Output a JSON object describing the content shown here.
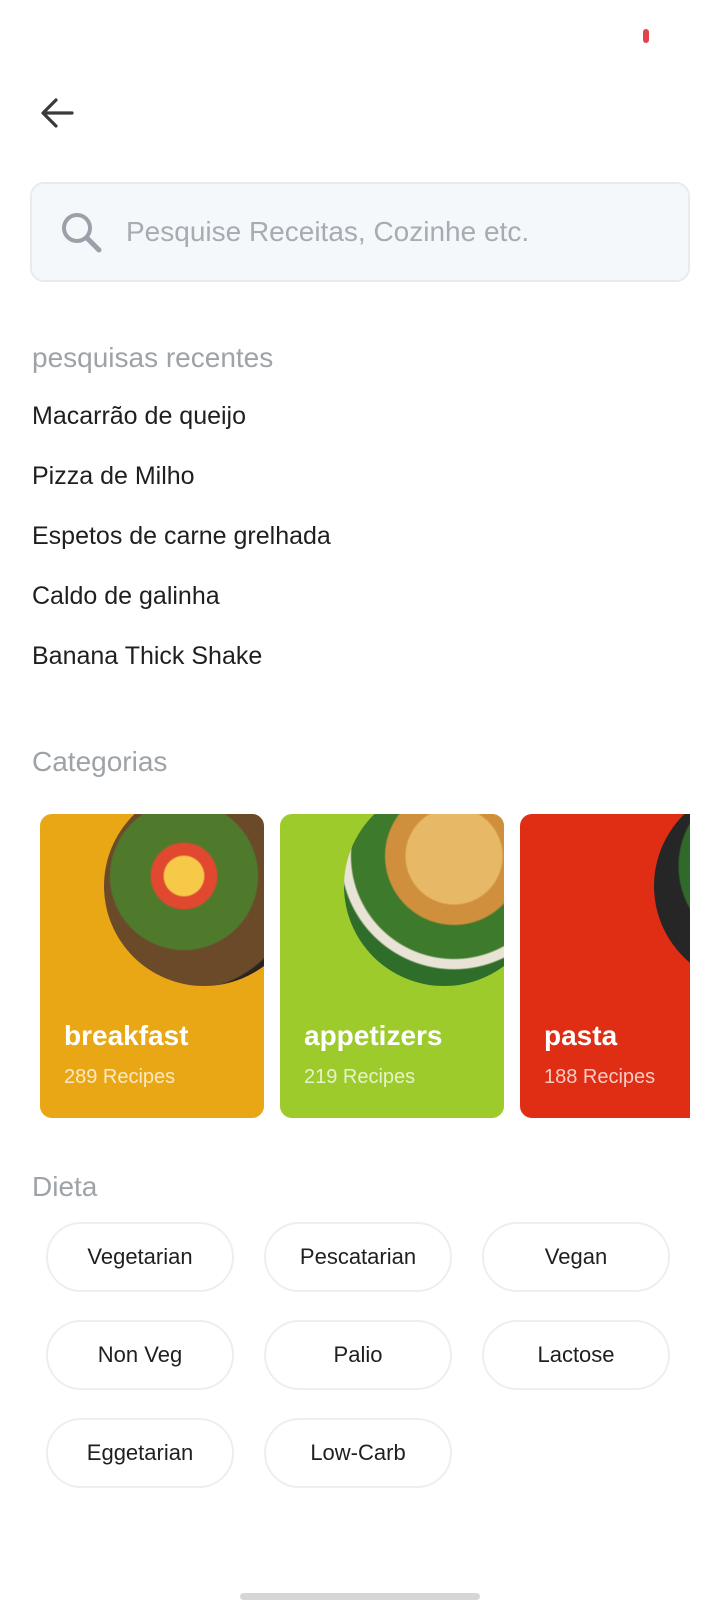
{
  "search": {
    "placeholder": "Pesquise Receitas, Cozinhe etc."
  },
  "recent": {
    "title": "pesquisas recentes",
    "items": [
      "Macarrão de queijo",
      "Pizza de Milho",
      "Espetos de carne grelhada",
      "Caldo de galinha",
      "Banana Thick Shake"
    ]
  },
  "categories": {
    "title": "Categorias",
    "items": [
      {
        "name": "breakfast",
        "count": "289 Recipes",
        "color": "#e9a715"
      },
      {
        "name": "appetizers",
        "count": "219 Recipes",
        "color": "#9ccb2b"
      },
      {
        "name": "pasta",
        "count": "188 Recipes",
        "color": "#df2e14"
      }
    ]
  },
  "diet": {
    "title": "Dieta",
    "chips": [
      "Vegetarian",
      "Pescatarian",
      "Vegan",
      "Non Veg",
      "Palio",
      "Lactose",
      "Eggetarian",
      "Low-Carb"
    ]
  },
  "icons": {
    "back": "arrow-left-icon",
    "search": "search-icon"
  }
}
